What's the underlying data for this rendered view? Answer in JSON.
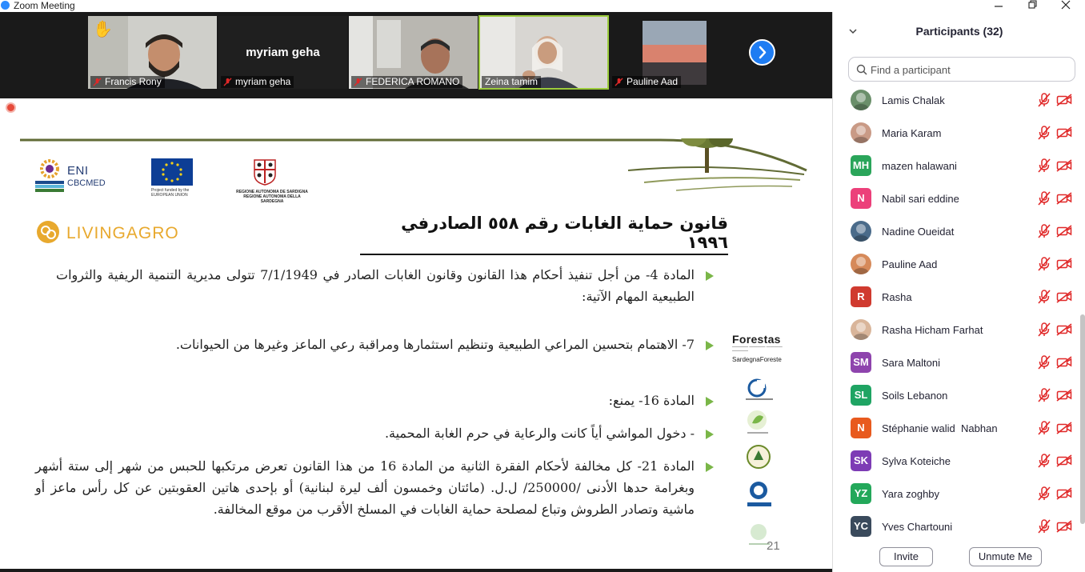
{
  "window": {
    "title": "Zoom Meeting"
  },
  "colors": {
    "accent": "#2d8cff",
    "mute_red": "#e02828",
    "bullet_green": "#7ab648",
    "active_speaker": "#9ccc3c"
  },
  "videos": [
    {
      "name": "Francis Rony",
      "muted": true,
      "hand_raised": true
    },
    {
      "name": "myriam geha",
      "muted": true,
      "video_off": true,
      "big_label": "myriam geha"
    },
    {
      "name": "FEDERICA ROMANO",
      "muted": true
    },
    {
      "name": "Zeina tamim",
      "muted": false,
      "active": true
    },
    {
      "name": "Pauline Aad",
      "muted": true
    }
  ],
  "slide": {
    "logos": {
      "eni": "ENI",
      "eni_line2": "CBCMED",
      "livingagro": "LIVINGAGRO",
      "forestas": "Forestas",
      "sardegna_foreste": "SardegnaForeste",
      "eu_caption": "Project funded by the EUROPEAN UNION",
      "sardegna_caption": "REGIONE AUTONOMA DE SARDIGNA REGIONE AUTONOMA DELLA SARDEGNA"
    },
    "title": "قانون حماية الغابات رقم ٥٥٨ الصادرفي ١٩٩٦",
    "paragraphs": [
      "المادة 4- من أجل تنفيذ أحكام هذا القانون وقانون الغابات الصادر في 7/1/1949 تتولى مديرية التنمية الريفية والثروات الطبيعية المهام الآتية:",
      "7- الاهتمام بتحسين المراعي الطبيعية وتنظيم استثمارها ومراقبة رعي الماعز وغيرها من الحيوانات.",
      "المادة 16- يمنع:",
      "- دخول المواشي أياً كانت والرعاية في حرم الغابة المحمية.",
      "المادة 21- كل مخالفة لأحكام الفقرة الثانية من المادة 16 من هذا القانون تعرض مرتكبها للحبس من شهر إلى ستة أشهر وبغرامة حدها الأدنى /250000/ ل.ل. (مائتان وخمسون ألف ليرة لبنانية) أو بإحدى هاتين العقوبتين عن كل رأس ماعز أو ماشية وتصادر الطروش وتباع لمصلحة حماية الغابات في المسلخ الأقرب من موقع المخالفة."
    ],
    "page_number": "21"
  },
  "participants": {
    "title": "Participants (32)",
    "search_placeholder": "Find a participant",
    "items": [
      {
        "name": "Lamis Chalak",
        "initials": "",
        "color": "#6a8f6a",
        "photo": true
      },
      {
        "name": "Maria Karam",
        "initials": "",
        "color": "#c99a86",
        "photo": true
      },
      {
        "name": "mazen halawani",
        "initials": "MH",
        "color": "#2aa55a"
      },
      {
        "name": "Nabil sari eddine",
        "initials": "N",
        "color": "#ec407a"
      },
      {
        "name": "Nadine Oueidat",
        "initials": "",
        "color": "#4a6b8a",
        "photo": true
      },
      {
        "name": "Pauline Aad",
        "initials": "",
        "color": "#d68a5a",
        "photo": true
      },
      {
        "name": "Rasha",
        "initials": "R",
        "color": "#d03a2f"
      },
      {
        "name": "Rasha Hicham Farhat",
        "initials": "",
        "color": "#d9b59a",
        "photo": true
      },
      {
        "name": "Sara Maltoni",
        "initials": "SM",
        "color": "#8e44ad"
      },
      {
        "name": "Soils Lebanon",
        "initials": "SL",
        "color": "#1fa463"
      },
      {
        "name": "Stéphanie walid  Nabhan",
        "initials": "N",
        "color": "#e85a1e"
      },
      {
        "name": "Sylva Koteiche",
        "initials": "SK",
        "color": "#7d3cb5"
      },
      {
        "name": "Yara zoghby",
        "initials": "YZ",
        "color": "#23a85a"
      },
      {
        "name": "Yves Chartouni",
        "initials": "YC",
        "color": "#3a4a5c"
      }
    ],
    "invite_label": "Invite",
    "unmute_label": "Unmute Me"
  }
}
